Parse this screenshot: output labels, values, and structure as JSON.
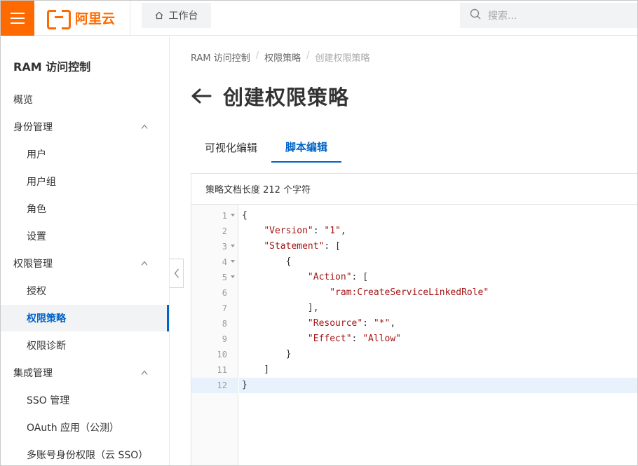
{
  "topbar": {
    "brand": "阿里云",
    "workbench_label": "工作台",
    "search_placeholder": "搜索..."
  },
  "colors": {
    "brand": "#ff6a00",
    "accent": "#0064c8"
  },
  "sidebar": {
    "title": "RAM 访问控制",
    "items": [
      {
        "label": "概览",
        "level": 1
      },
      {
        "label": "身份管理",
        "level": 1,
        "expandable": true
      },
      {
        "label": "用户",
        "level": 2
      },
      {
        "label": "用户组",
        "level": 2
      },
      {
        "label": "角色",
        "level": 2
      },
      {
        "label": "设置",
        "level": 2
      },
      {
        "label": "权限管理",
        "level": 1,
        "expandable": true
      },
      {
        "label": "授权",
        "level": 2
      },
      {
        "label": "权限策略",
        "level": 2,
        "active": true
      },
      {
        "label": "权限诊断",
        "level": 2
      },
      {
        "label": "集成管理",
        "level": 1,
        "expandable": true
      },
      {
        "label": "SSO 管理",
        "level": 2
      },
      {
        "label": "OAuth 应用（公测）",
        "level": 2
      },
      {
        "label": "多账号身份权限（云 SSO）",
        "level": 2
      }
    ]
  },
  "breadcrumb": [
    "RAM 访问控制",
    "权限策略",
    "创建权限策略"
  ],
  "page_title": "创建权限策略",
  "tabs": [
    {
      "label": "可视化编辑",
      "active": false
    },
    {
      "label": "脚本编辑",
      "active": true
    }
  ],
  "editor": {
    "status": "策略文档长度 212 个字符",
    "lines": [
      {
        "n": "1",
        "fold": true,
        "text": "{"
      },
      {
        "n": "2",
        "fold": false,
        "text": "    \"Version\": \"1\","
      },
      {
        "n": "3",
        "fold": true,
        "text": "    \"Statement\": ["
      },
      {
        "n": "4",
        "fold": true,
        "text": "        {"
      },
      {
        "n": "5",
        "fold": true,
        "text": "            \"Action\": ["
      },
      {
        "n": "6",
        "fold": false,
        "text": "                \"ram:CreateServiceLinkedRole\""
      },
      {
        "n": "7",
        "fold": false,
        "text": "            ],"
      },
      {
        "n": "8",
        "fold": false,
        "text": "            \"Resource\": \"*\","
      },
      {
        "n": "9",
        "fold": false,
        "text": "            \"Effect\": \"Allow\""
      },
      {
        "n": "10",
        "fold": false,
        "text": "        }"
      },
      {
        "n": "11",
        "fold": false,
        "text": "    ]"
      },
      {
        "n": "12",
        "fold": false,
        "text": "}",
        "highlight": true
      }
    ]
  }
}
